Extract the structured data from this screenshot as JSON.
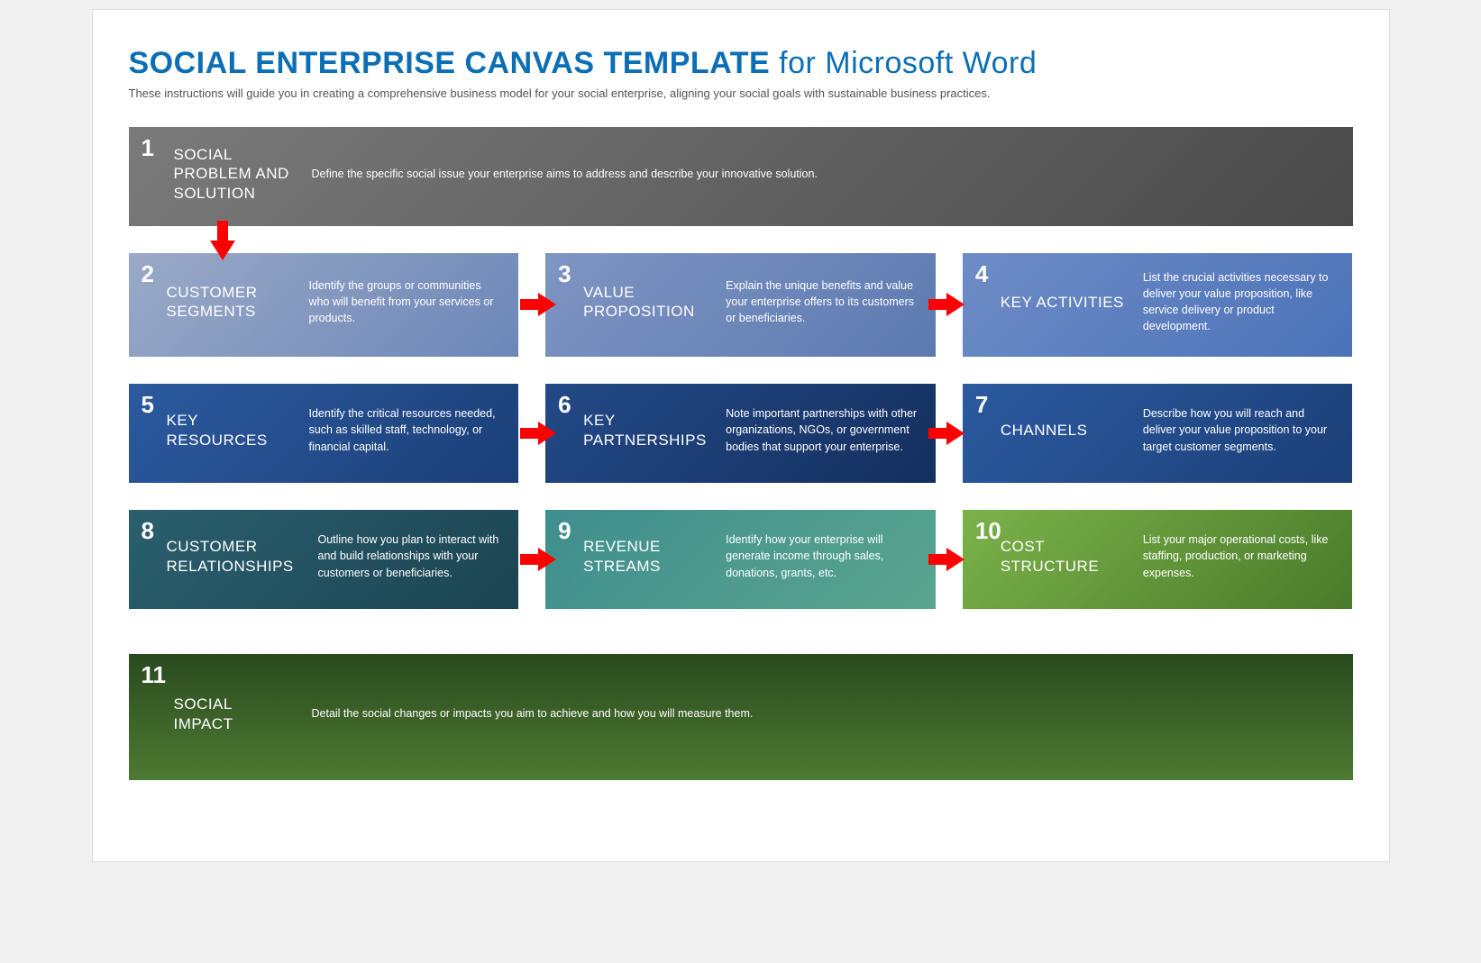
{
  "title_bold": "SOCIAL ENTERPRISE CANVAS TEMPLATE",
  "title_thin": " for Microsoft Word",
  "subtitle": "These instructions will guide you in creating a comprehensive business model for your social enterprise, aligning your social goals with sustainable business practices.",
  "cards": {
    "c1": {
      "num": "1",
      "title": "SOCIAL PROBLEM AND SOLUTION",
      "desc": "Define the specific social issue your enterprise aims to address and describe your innovative solution."
    },
    "c2": {
      "num": "2",
      "title": "CUSTOMER SEGMENTS",
      "desc": "Identify the groups or communities who will benefit from your services or products."
    },
    "c3": {
      "num": "3",
      "title": "VALUE PROPOSITION",
      "desc": "Explain the unique benefits and value your enterprise offers to its customers or beneficiaries."
    },
    "c4": {
      "num": "4",
      "title": "KEY ACTIVITIES",
      "desc": "List the crucial activities necessary to deliver your value proposition, like service delivery or product development."
    },
    "c5": {
      "num": "5",
      "title": "KEY RESOURCES",
      "desc": "Identify the critical resources needed, such as skilled staff, technology, or financial capital."
    },
    "c6": {
      "num": "6",
      "title": "KEY PARTNERSHIPS",
      "desc": "Note important partnerships with other organizations, NGOs, or government bodies that support your enterprise."
    },
    "c7": {
      "num": "7",
      "title": "CHANNELS",
      "desc": "Describe how you will reach and deliver your value proposition to your target customer segments."
    },
    "c8": {
      "num": "8",
      "title": "CUSTOMER RELATIONSHIPS",
      "desc": "Outline how you plan to interact with and build relationships with your customers or beneficiaries."
    },
    "c9": {
      "num": "9",
      "title": "REVENUE STREAMS",
      "desc": "Identify how your enterprise will generate income through sales, donations, grants, etc."
    },
    "c10": {
      "num": "10",
      "title": "COST STRUCTURE",
      "desc": "List your major operational costs, like staffing, production, or marketing expenses."
    },
    "c11": {
      "num": "11",
      "title": "SOCIAL IMPACT",
      "desc": "Detail the social changes or impacts you aim to achieve and how you will measure them."
    }
  }
}
